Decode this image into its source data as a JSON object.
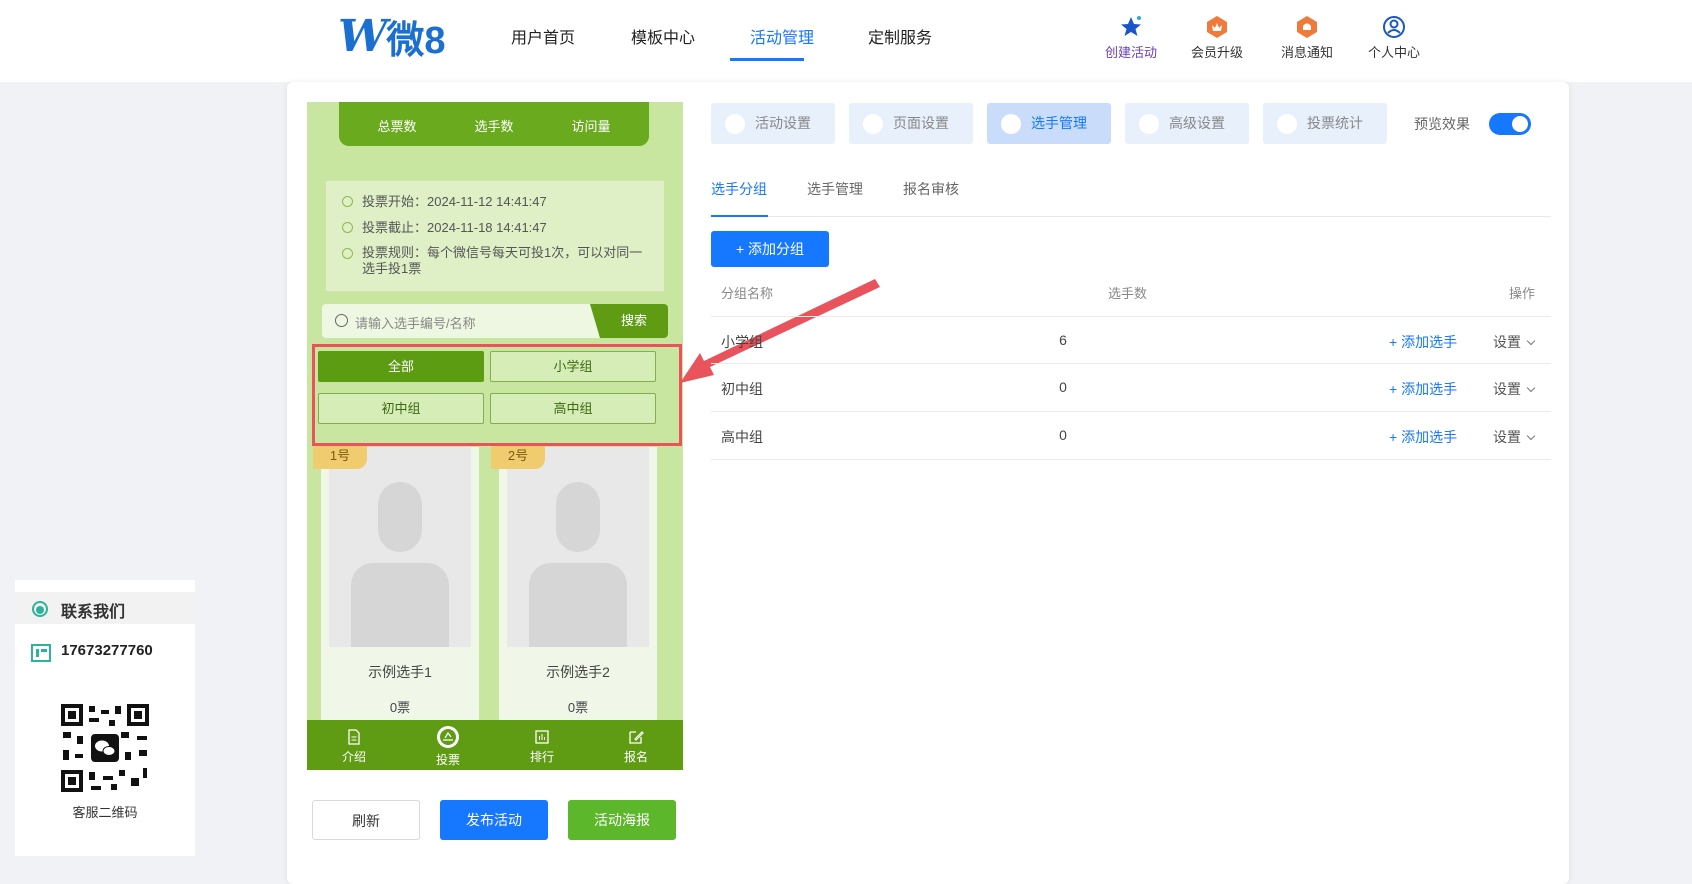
{
  "header": {
    "logo_text": "微8",
    "nav": [
      "用户首页",
      "模板中心",
      "活动管理",
      "定制服务"
    ],
    "nav_active": "活动管理",
    "icons": [
      {
        "label": "创建活动",
        "icon": "star-icon"
      },
      {
        "label": "会员升级",
        "icon": "crown-icon"
      },
      {
        "label": "消息通知",
        "icon": "bell-icon"
      },
      {
        "label": "个人中心",
        "icon": "user-icon"
      }
    ]
  },
  "preview": {
    "stats": [
      "总票数",
      "选手数",
      "访问量"
    ],
    "info": {
      "start": "投票开始：2024-11-12 14:41:47",
      "end": "投票截止：2024-11-18 14:41:47",
      "rule": "投票规则：每个微信号每天可投1次，可以对同一选手投1票"
    },
    "search_placeholder": "请输入选手编号/名称",
    "search_button": "搜索",
    "groups": [
      "全部",
      "小学组",
      "初中组",
      "高中组"
    ],
    "contestants": [
      {
        "number": "1号",
        "name": "示例选手1",
        "votes": "0票"
      },
      {
        "number": "2号",
        "name": "示例选手2",
        "votes": "0票"
      }
    ],
    "tabbar": [
      "介绍",
      "投票",
      "排行",
      "报名"
    ]
  },
  "actions": {
    "refresh": "刷新",
    "publish": "发布活动",
    "poster": "活动海报"
  },
  "settings_tabs": [
    "活动设置",
    "页面设置",
    "选手管理",
    "高级设置",
    "投票统计"
  ],
  "settings_active": "选手管理",
  "preview_toggle_label": "预览效果",
  "preview_toggle_on": true,
  "sub_tabs": [
    "选手分组",
    "选手管理",
    "报名审核"
  ],
  "sub_active": "选手分组",
  "add_group_button": "添加分组",
  "table": {
    "headers": [
      "分组名称",
      "选手数",
      "操作"
    ],
    "rows": [
      {
        "name": "小学组",
        "count": "6",
        "add": "添加选手",
        "setting": "设置"
      },
      {
        "name": "初中组",
        "count": "0",
        "add": "添加选手",
        "setting": "设置"
      },
      {
        "name": "高中组",
        "count": "0",
        "add": "添加选手",
        "setting": "设置"
      }
    ]
  },
  "contact": {
    "title": "联系我们",
    "phone": "17673277760",
    "qr_label": "客服二维码"
  },
  "colors": {
    "primary": "#1677ff",
    "green": "#5f9c14",
    "highlight": "#e8535c"
  }
}
